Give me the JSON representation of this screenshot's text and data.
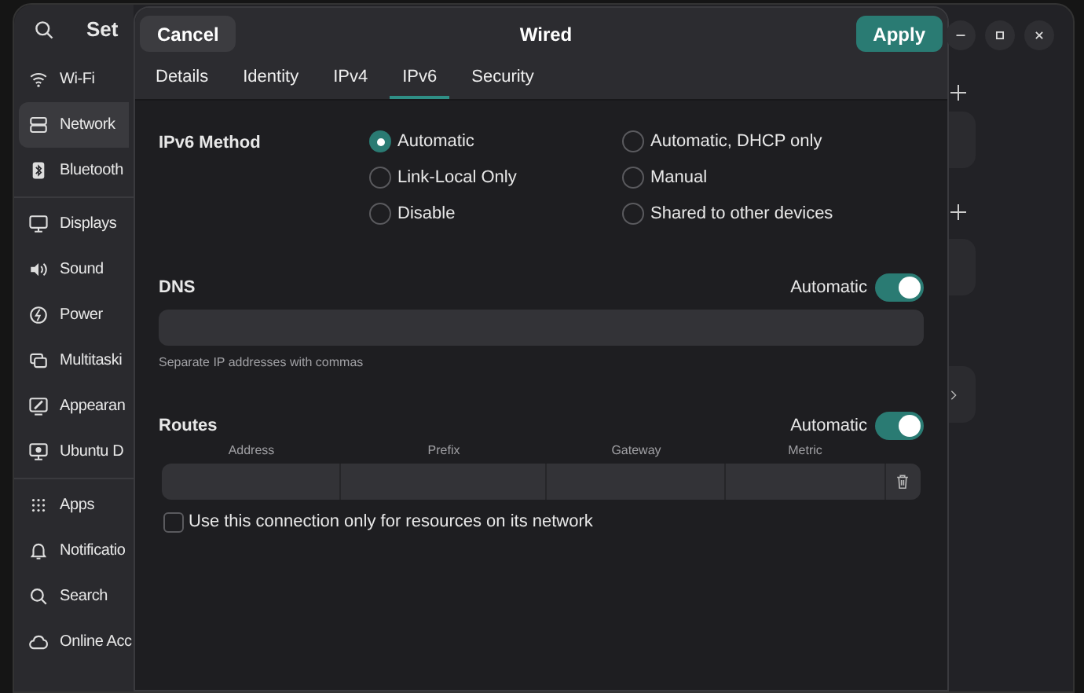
{
  "settings_window": {
    "title": "Set"
  },
  "sidebar": {
    "sections": [
      {
        "items": [
          {
            "label": "Wi-Fi",
            "kind": "wifi",
            "selected": false
          },
          {
            "label": "Network",
            "kind": "network",
            "selected": true
          },
          {
            "label": "Bluetooth",
            "kind": "bluetooth",
            "selected": false
          }
        ]
      },
      {
        "items": [
          {
            "label": "Displays",
            "kind": "display",
            "selected": false
          },
          {
            "label": "Sound",
            "kind": "sound",
            "selected": false
          },
          {
            "label": "Power",
            "kind": "power",
            "selected": false
          },
          {
            "label": "Multitaski",
            "kind": "multitask",
            "selected": false
          },
          {
            "label": "Appearan",
            "kind": "appearance",
            "selected": false
          },
          {
            "label": "Ubuntu D",
            "kind": "desktop",
            "selected": false
          }
        ]
      },
      {
        "items": [
          {
            "label": "Apps",
            "kind": "apps",
            "selected": false
          },
          {
            "label": "Notificatio",
            "kind": "bell",
            "selected": false
          },
          {
            "label": "Search",
            "kind": "search",
            "selected": false
          },
          {
            "label": "Online Acc",
            "kind": "cloud",
            "selected": false
          }
        ]
      }
    ]
  },
  "dialog": {
    "title": "Wired",
    "cancel": "Cancel",
    "apply": "Apply",
    "tabs": [
      {
        "label": "Details",
        "selected": false
      },
      {
        "label": "Identity",
        "selected": false
      },
      {
        "label": "IPv4",
        "selected": false
      },
      {
        "label": "IPv6",
        "selected": true
      },
      {
        "label": "Security",
        "selected": false
      }
    ],
    "method": {
      "label": "IPv6 Method",
      "options": [
        {
          "label": "Automatic",
          "selected": true
        },
        {
          "label": "Automatic, DHCP only",
          "selected": false
        },
        {
          "label": "Link-Local Only",
          "selected": false
        },
        {
          "label": "Manual",
          "selected": false
        },
        {
          "label": "Disable",
          "selected": false
        },
        {
          "label": "Shared to other devices",
          "selected": false
        }
      ]
    },
    "dns": {
      "label": "DNS",
      "toggle_label": "Automatic",
      "on": true,
      "hint": "Separate IP addresses with commas"
    },
    "routes": {
      "label": "Routes",
      "toggle_label": "Automatic",
      "on": true,
      "columns": [
        "Address",
        "Prefix",
        "Gateway",
        "Metric"
      ]
    },
    "local_only": {
      "label": "Use this connection only for resources on its network",
      "checked": false
    }
  }
}
